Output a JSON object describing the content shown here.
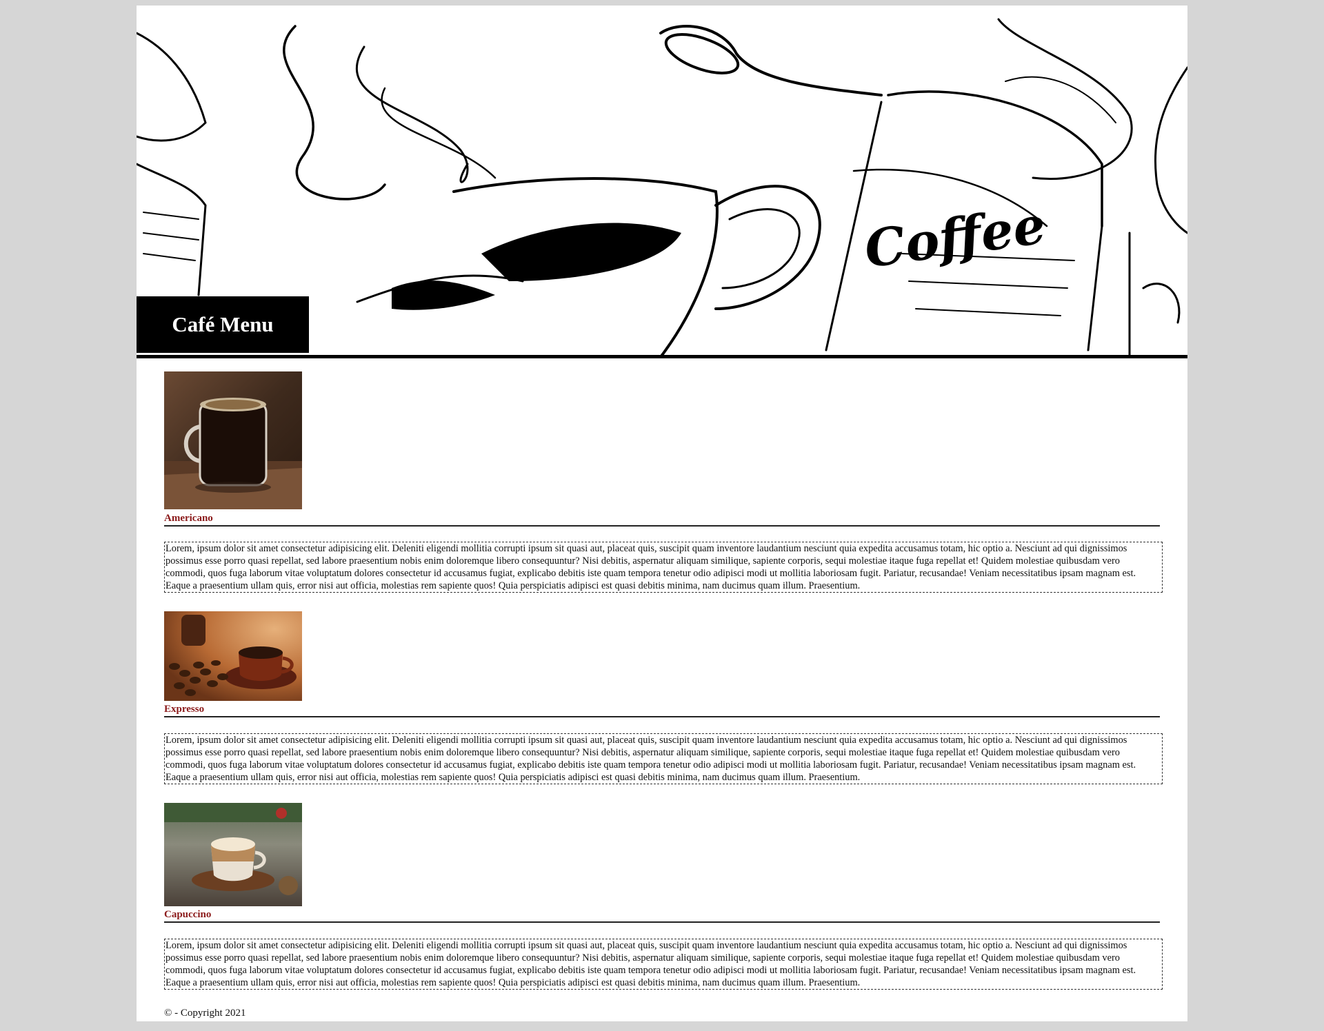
{
  "header": {
    "title": "Café Menu",
    "banner_text": "Coffee"
  },
  "menu": {
    "items": [
      {
        "name": "Americano",
        "image_icon": "americano-cup-photo",
        "description": "Lorem, ipsum dolor sit amet consectetur adipisicing elit. Deleniti eligendi mollitia corrupti ipsum sit quasi aut, placeat quis, suscipit quam inventore laudantium nesciunt quia expedita accusamus totam, hic optio a. Nesciunt ad qui dignissimos possimus esse porro quasi repellat, sed labore praesentium nobis enim doloremque libero consequuntur? Nisi debitis, aspernatur aliquam similique, sapiente corporis, sequi molestiae itaque fuga repellat et! Quidem molestiae quibusdam vero commodi, quos fuga laborum vitae voluptatum dolores consectetur id accusamus fugiat, explicabo debitis iste quam tempora tenetur odio adipisci modi ut mollitia laboriosam fugit. Pariatur, recusandae! Veniam necessitatibus ipsam magnam est. Eaque a praesentium ullam quis, error nisi aut officia, molestias rem sapiente quos! Quia perspiciatis adipisci est quasi debitis minima, nam ducimus quam illum. Praesentium."
      },
      {
        "name": "Expresso",
        "image_icon": "espresso-beans-photo",
        "description": "Lorem, ipsum dolor sit amet consectetur adipisicing elit. Deleniti eligendi mollitia corrupti ipsum sit quasi aut, placeat quis, suscipit quam inventore laudantium nesciunt quia expedita accusamus totam, hic optio a. Nesciunt ad qui dignissimos possimus esse porro quasi repellat, sed labore praesentium nobis enim doloremque libero consequuntur? Nisi debitis, aspernatur aliquam similique, sapiente corporis, sequi molestiae itaque fuga repellat et! Quidem molestiae quibusdam vero commodi, quos fuga laborum vitae voluptatum dolores consectetur id accusamus fugiat, explicabo debitis iste quam tempora tenetur odio adipisci modi ut mollitia laboriosam fugit. Pariatur, recusandae! Veniam necessitatibus ipsam magnam est. Eaque a praesentium ullam quis, error nisi aut officia, molestias rem sapiente quos! Quia perspiciatis adipisci est quasi debitis minima, nam ducimus quam illum. Praesentium."
      },
      {
        "name": "Capuccino",
        "image_icon": "cappuccino-cup-photo",
        "description": "Lorem, ipsum dolor sit amet consectetur adipisicing elit. Deleniti eligendi mollitia corrupti ipsum sit quasi aut, placeat quis, suscipit quam inventore laudantium nesciunt quia expedita accusamus totam, hic optio a. Nesciunt ad qui dignissimos possimus esse porro quasi repellat, sed labore praesentium nobis enim doloremque libero consequuntur? Nisi debitis, aspernatur aliquam similique, sapiente corporis, sequi molestiae itaque fuga repellat et! Quidem molestiae quibusdam vero commodi, quos fuga laborum vitae voluptatum dolores consectetur id accusamus fugiat, explicabo debitis iste quam tempora tenetur odio adipisci modi ut mollitia laboriosam fugit. Pariatur, recusandae! Veniam necessitatibus ipsam magnam est. Eaque a praesentium ullam quis, error nisi aut officia, molestias rem sapiente quos! Quia perspiciatis adipisci est quasi debitis minima, nam ducimus quam illum. Praesentium."
      }
    ]
  },
  "footer": {
    "copyright": "© - Copyright 2021"
  },
  "colors": {
    "page_background": "#d6d6d6",
    "item_name": "#8b1a1a",
    "title_box": "#000000"
  }
}
